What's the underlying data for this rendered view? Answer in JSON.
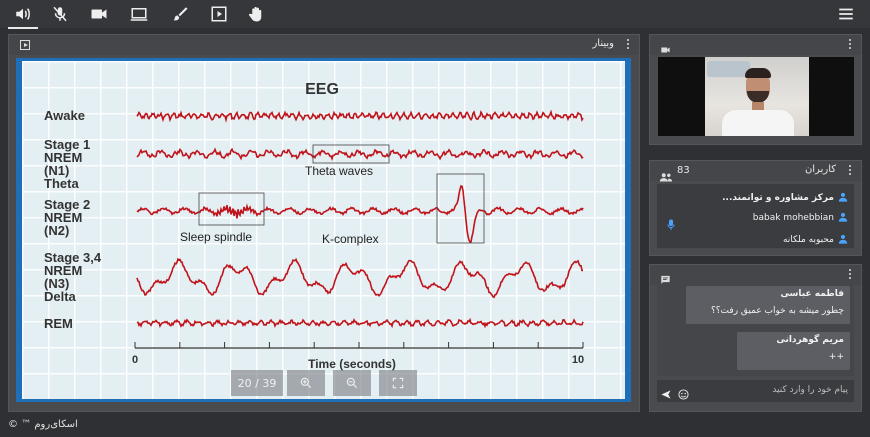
{
  "toolbar": {
    "icons": [
      "speaker-icon",
      "mic-off-icon",
      "camera-icon",
      "screen-share-icon",
      "brush-icon",
      "play-box-icon",
      "hand-icon"
    ],
    "menu_icon": "hamburger-menu-icon"
  },
  "main_panel": {
    "title": "وبینار",
    "slide": {
      "title": "EEG",
      "stages": [
        "Awake",
        "Stage 1",
        "NREM",
        "(N1)",
        "Theta",
        "Stage 2",
        "NREM",
        "(N2)",
        "Stage 3,4",
        "NREM",
        "(N3)",
        "Delta",
        "REM"
      ],
      "annotations": {
        "theta_waves": "Theta waves",
        "sleep_spindle": "Sleep spindle",
        "k_complex": "K-complex"
      },
      "x_axis": {
        "start": "0",
        "end": "10",
        "label": "Time (seconds)"
      },
      "trace_color": "#c0141c"
    },
    "controls": {
      "page_indicator": "20 / 39",
      "zoom_in_icon": "zoom-in-icon",
      "zoom_out_icon": "zoom-out-icon",
      "fullscreen_icon": "fullscreen-icon"
    }
  },
  "video_panel": {
    "icon": "camera-icon"
  },
  "users_panel": {
    "title": "کاربران",
    "count": "83",
    "users": [
      {
        "name": "مرکز مشاوره و توانمند..."
      },
      {
        "name": "babak mohebbian"
      },
      {
        "name": "محبوبه ملکانه"
      }
    ]
  },
  "chat_panel": {
    "messages": [
      {
        "sender": "فاطمه عباسی",
        "text": "چطور میشه به خواب عمیق رفت؟؟"
      },
      {
        "sender": "مریم گوهردانی",
        "text": "++"
      }
    ],
    "input_placeholder": "پیام خود را وارد کنید"
  },
  "footer": {
    "brand": "اسکای‌روم ™ ©"
  },
  "colors": {
    "accent": "#1f6fb8",
    "mic_active": "#4aa3ff",
    "background": "#2f3034"
  }
}
